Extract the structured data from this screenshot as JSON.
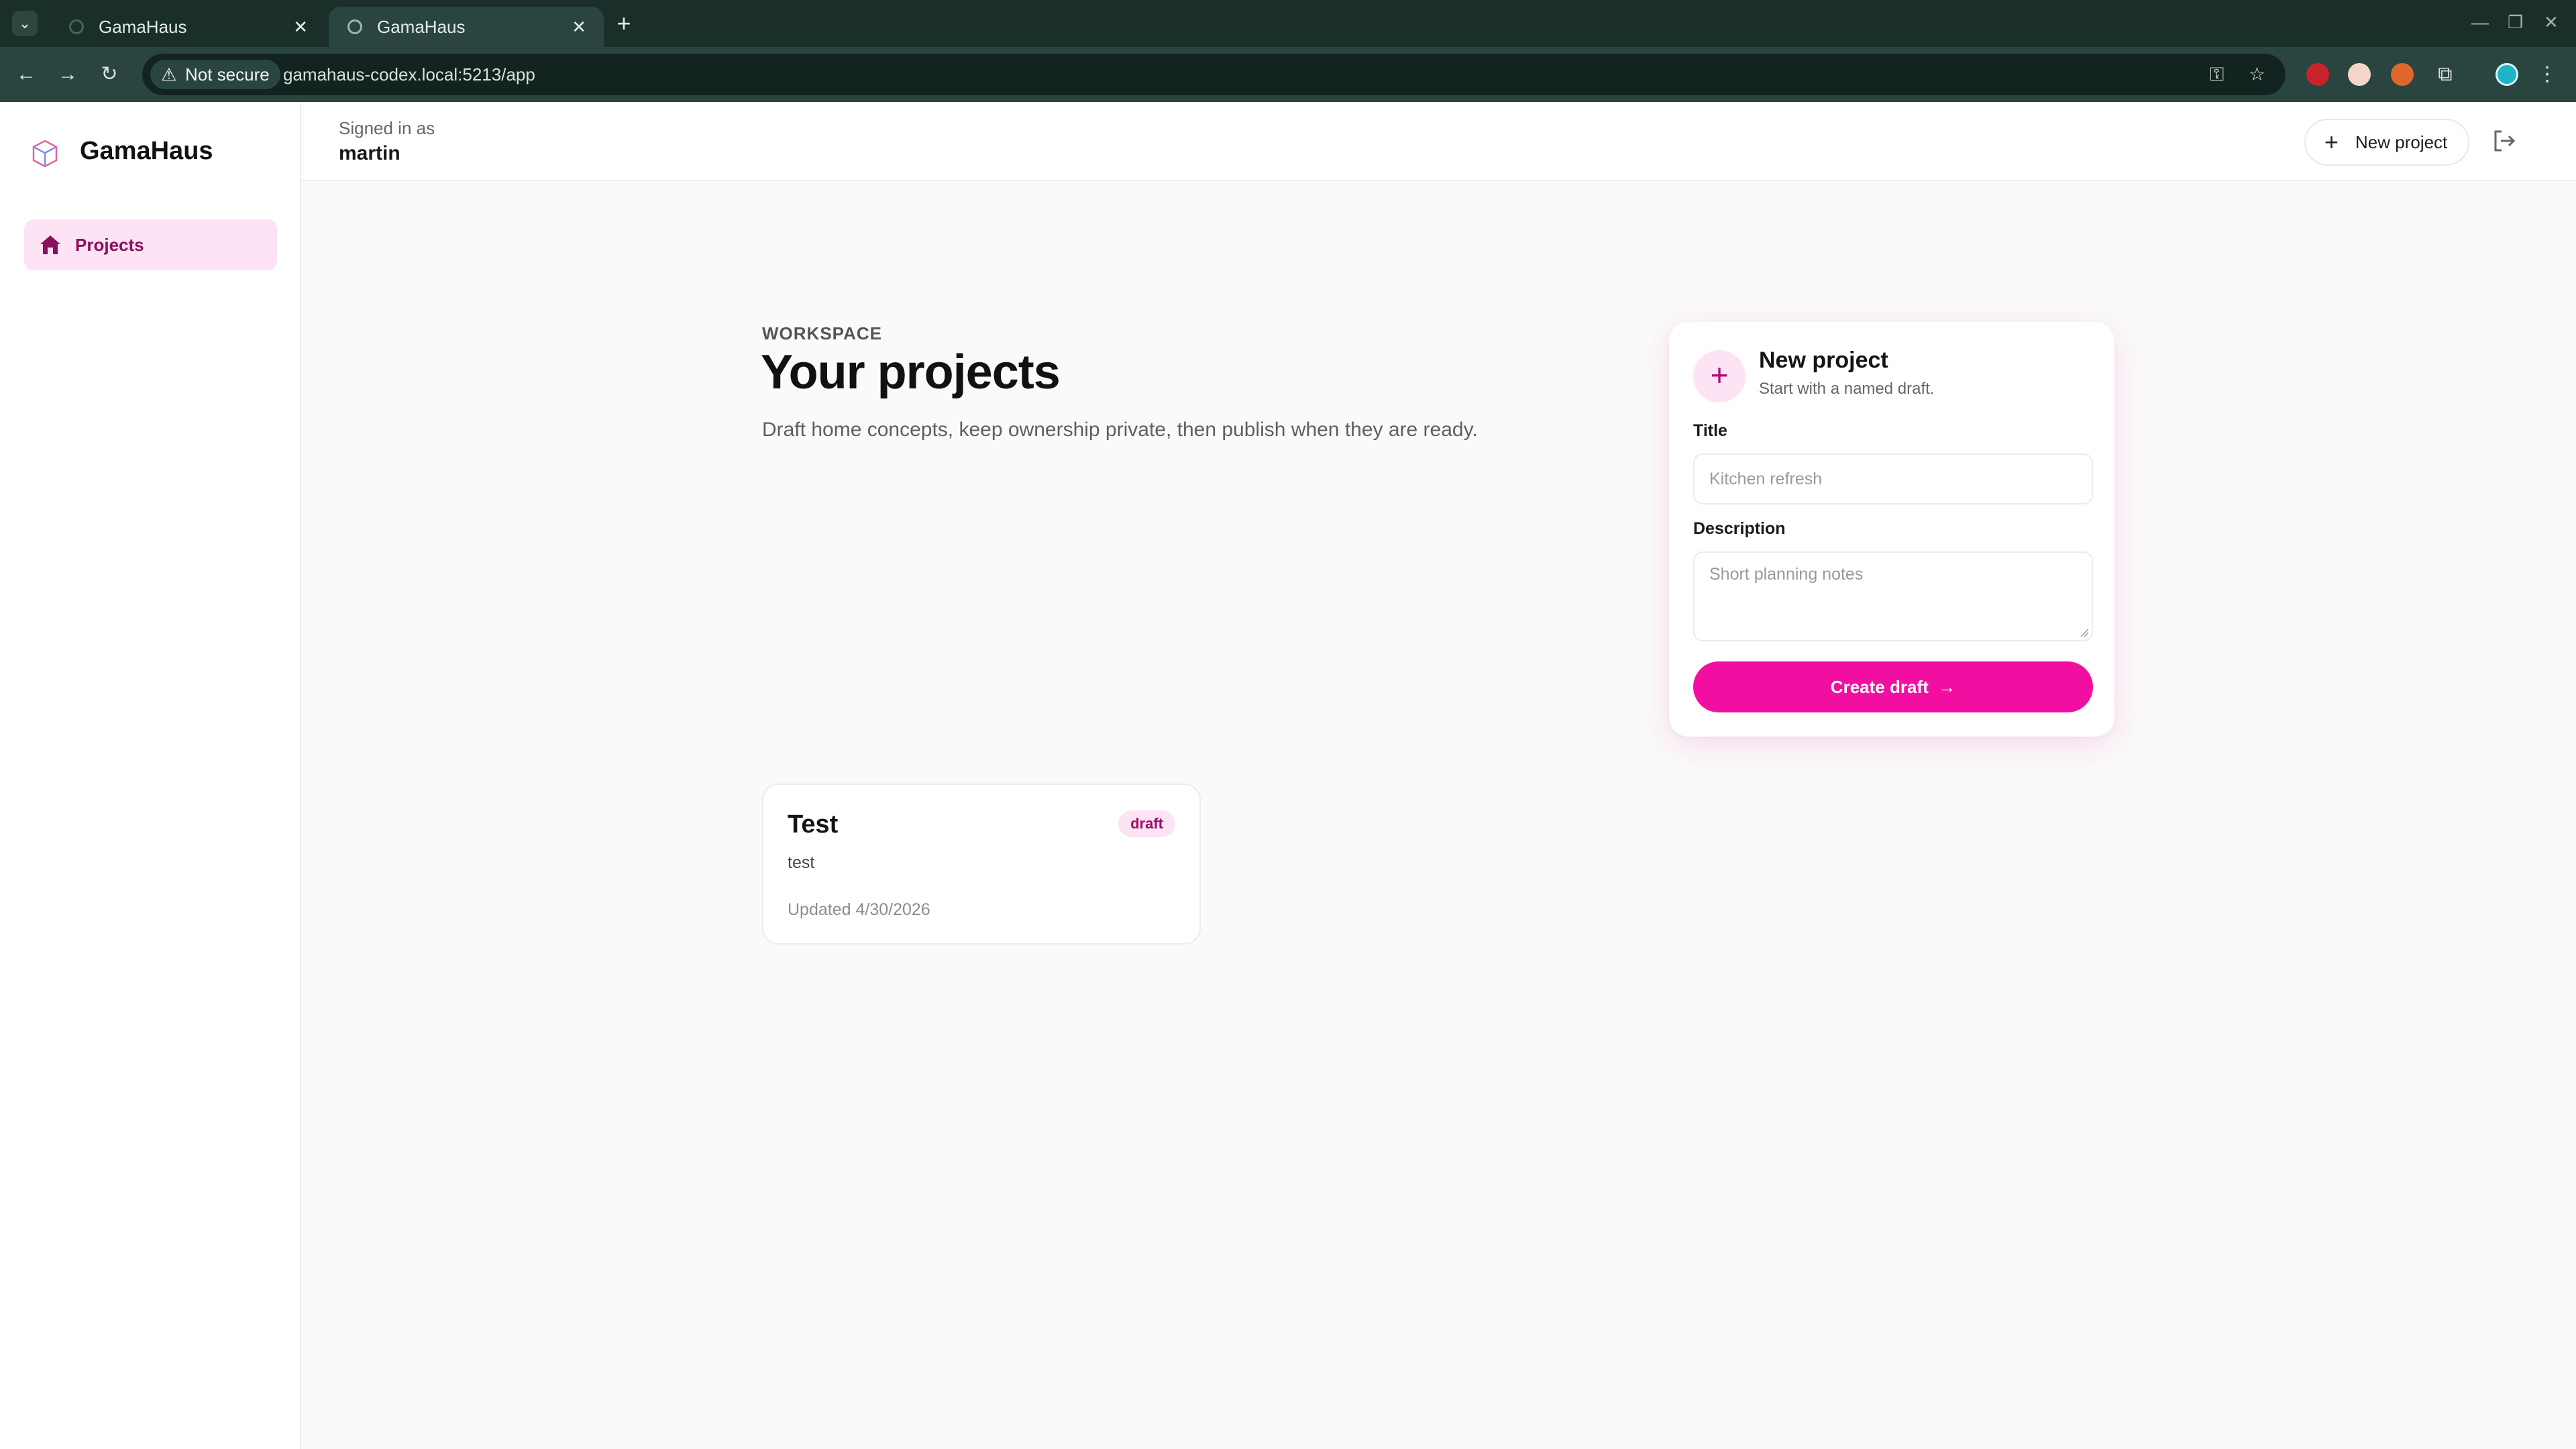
{
  "browser": {
    "tabs": [
      {
        "title": "GamaHaus",
        "active": false
      },
      {
        "title": "GamaHaus",
        "active": true
      }
    ],
    "security_label": "Not secure",
    "url": "gamahaus-codex.local:5213/app"
  },
  "app": {
    "brand": "GamaHaus",
    "accent_color": "#f20ea0",
    "sidebar": {
      "items": [
        {
          "label": "Projects",
          "icon": "home-icon",
          "active": true
        }
      ]
    },
    "topbar": {
      "signed_in_label": "Signed in as",
      "username": "martin",
      "new_project_label": "New project"
    },
    "main": {
      "eyebrow": "WORKSPACE",
      "title": "Your projects",
      "subtitle": "Draft home concepts, keep ownership private, then publish when they are ready."
    },
    "new_project_card": {
      "title": "New project",
      "subtitle": "Start with a named draft.",
      "title_label": "Title",
      "title_placeholder": "Kitchen refresh",
      "description_label": "Description",
      "description_placeholder": "Short planning notes",
      "submit_label": "Create draft"
    },
    "projects": [
      {
        "title": "Test",
        "status": "draft",
        "description": "test",
        "updated": "Updated 4/30/2026"
      }
    ]
  }
}
